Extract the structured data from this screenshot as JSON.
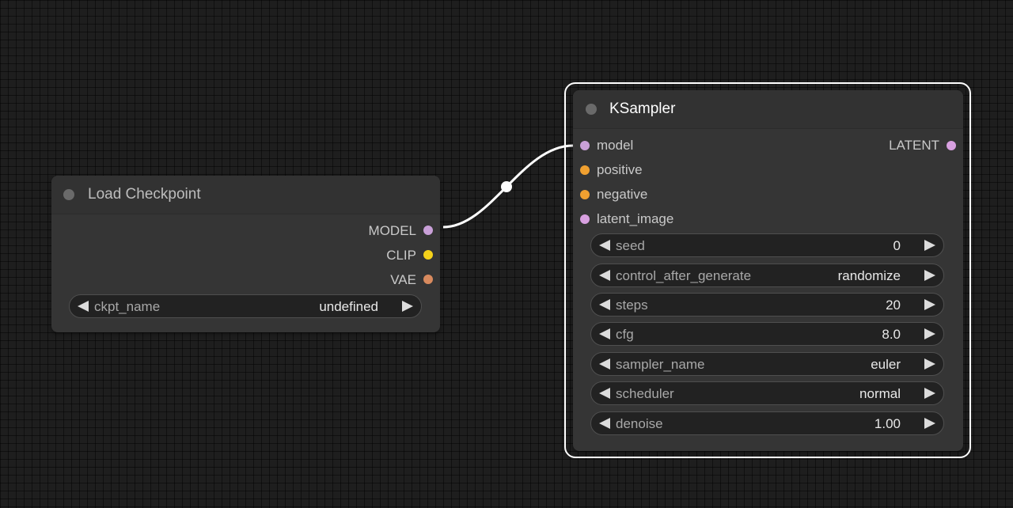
{
  "canvas": {
    "background": "#1e1e1e",
    "grid_color": "#141414"
  },
  "colors": {
    "model_slot": "#c9a0d8",
    "clip_slot": "#f5d21a",
    "vae_slot": "#d88a5e",
    "conditioning_slot": "#f0a030",
    "latent_slot": "#d8a0e0",
    "link": "#ffffff",
    "selection_outline": "#ffffff"
  },
  "nodes": {
    "load_checkpoint": {
      "title": "Load Checkpoint",
      "selected": false,
      "outputs": [
        {
          "label": "MODEL",
          "type": "model"
        },
        {
          "label": "CLIP",
          "type": "clip"
        },
        {
          "label": "VAE",
          "type": "vae"
        }
      ],
      "widgets": [
        {
          "name": "ckpt_name",
          "value": "undefined"
        }
      ]
    },
    "ksampler": {
      "title": "KSampler",
      "selected": true,
      "inputs": [
        {
          "label": "model",
          "type": "model"
        },
        {
          "label": "positive",
          "type": "conditioning"
        },
        {
          "label": "negative",
          "type": "conditioning"
        },
        {
          "label": "latent_image",
          "type": "latent"
        }
      ],
      "outputs": [
        {
          "label": "LATENT",
          "type": "latent"
        }
      ],
      "widgets": [
        {
          "name": "seed",
          "value": "0"
        },
        {
          "name": "control_after_generate",
          "value": "randomize"
        },
        {
          "name": "steps",
          "value": "20"
        },
        {
          "name": "cfg",
          "value": "8.0"
        },
        {
          "name": "sampler_name",
          "value": "euler"
        },
        {
          "name": "scheduler",
          "value": "normal"
        },
        {
          "name": "denoise",
          "value": "1.00"
        }
      ]
    }
  },
  "links": [
    {
      "from": "load_checkpoint.MODEL",
      "to": "ksampler.model"
    }
  ]
}
